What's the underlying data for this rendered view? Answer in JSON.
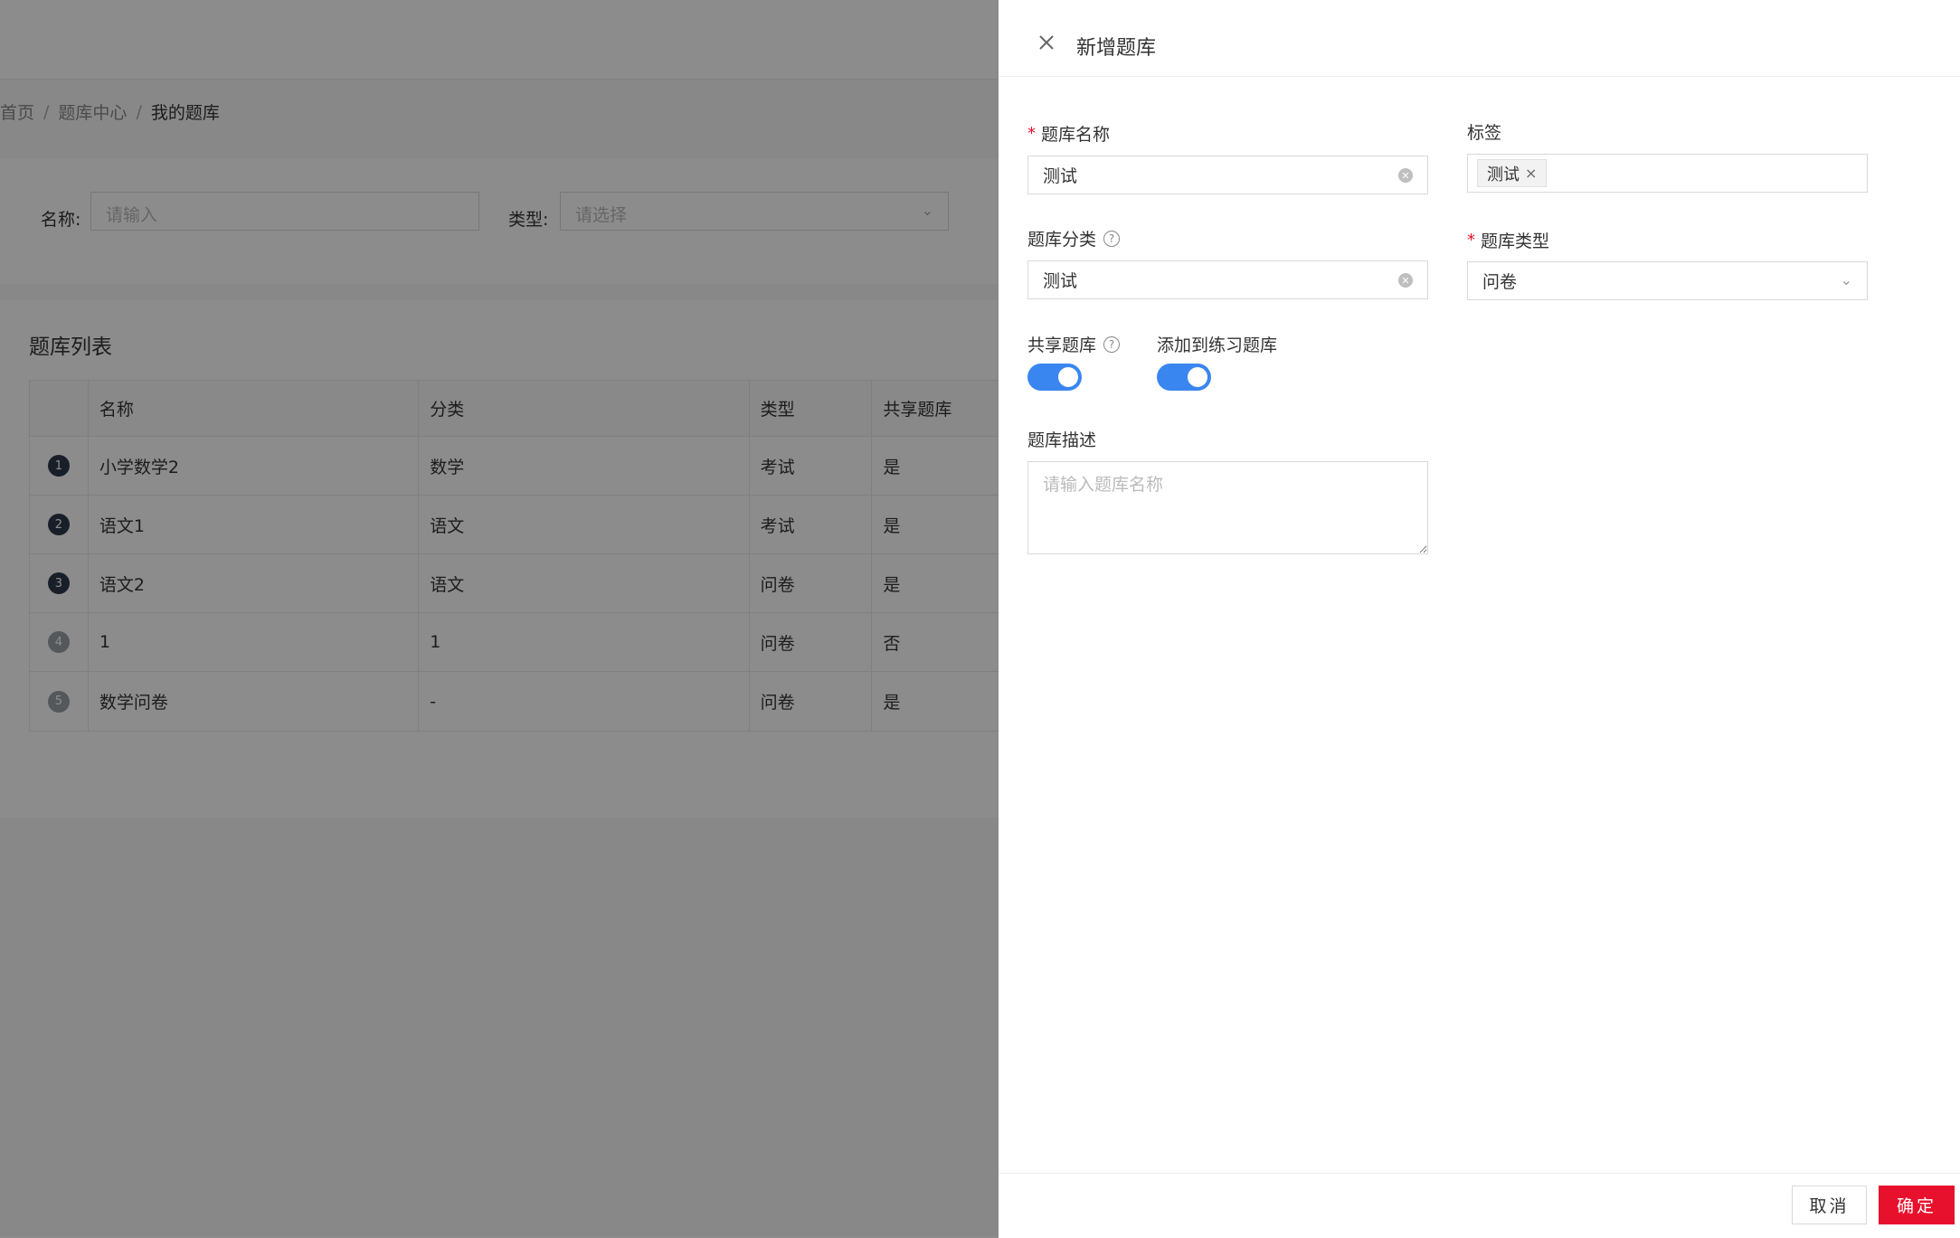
{
  "breadcrumb": {
    "items": [
      "首页",
      "题库中心"
    ],
    "current": "我的题库",
    "separator": "/"
  },
  "filter": {
    "name_label": "名称:",
    "name_placeholder": "请输入",
    "type_label": "类型:",
    "type_placeholder": "请选择"
  },
  "list": {
    "title": "题库列表",
    "columns": [
      "名称",
      "分类",
      "类型",
      "共享题库"
    ],
    "rows": [
      {
        "index": "1",
        "name": "小学数学2",
        "category": "数学",
        "type": "考试",
        "shared": "是"
      },
      {
        "index": "2",
        "name": "语文1",
        "category": "语文",
        "type": "考试",
        "shared": "是"
      },
      {
        "index": "3",
        "name": "语文2",
        "category": "语文",
        "type": "问卷",
        "shared": "是"
      },
      {
        "index": "4",
        "name": "1",
        "category": "1",
        "type": "问卷",
        "shared": "否"
      },
      {
        "index": "5",
        "name": "数学问卷",
        "category": "-",
        "type": "问卷",
        "shared": "是"
      }
    ]
  },
  "drawer": {
    "title": "新增题库",
    "close_icon": "close-icon",
    "bank_name": {
      "label": "题库名称",
      "required": "*",
      "value": "测试"
    },
    "tags": {
      "label": "标签",
      "items": [
        "测试"
      ]
    },
    "category": {
      "label": "题库分类",
      "value": "测试"
    },
    "bank_type": {
      "label": "题库类型",
      "required": "*",
      "value": "问卷"
    },
    "shared": {
      "label": "共享题库",
      "on": true
    },
    "practice": {
      "label": "添加到练习题库",
      "on": true
    },
    "description": {
      "label": "题库描述",
      "placeholder": "请输入题库名称"
    },
    "cancel_label": "取消",
    "confirm_label": "确定"
  },
  "colors": {
    "accent": "#3a86f0",
    "confirm": "#e8112d",
    "required": "#e8112d"
  }
}
